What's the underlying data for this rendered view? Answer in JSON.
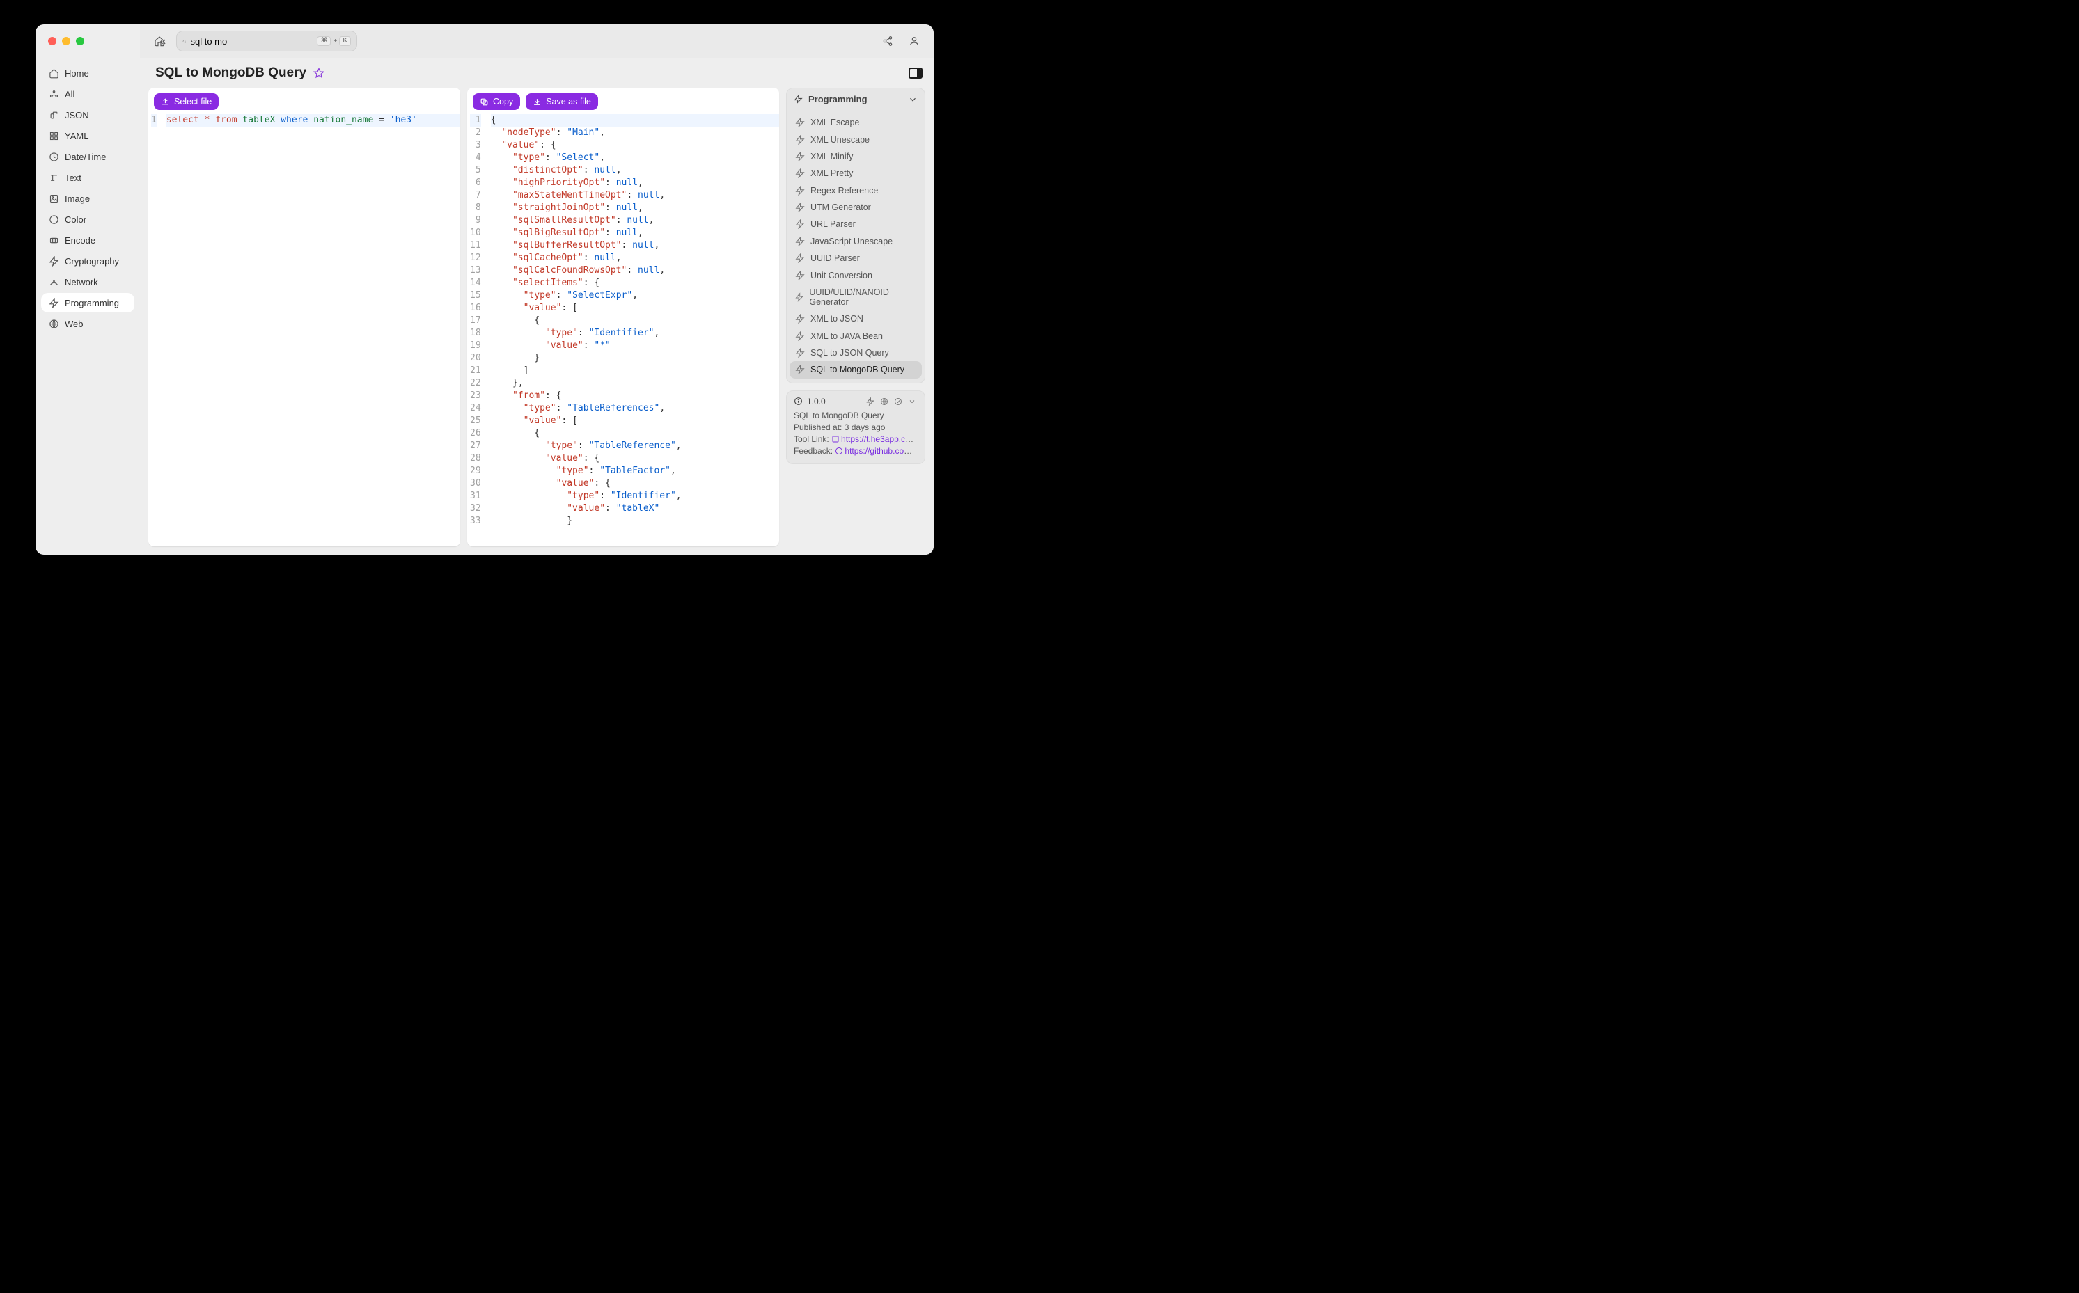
{
  "search": {
    "value": "sql to mo",
    "shortcut_mod": "⌘",
    "shortcut_plus": "+",
    "shortcut_key": "K"
  },
  "sidebar": {
    "items": [
      {
        "label": "Home"
      },
      {
        "label": "All"
      },
      {
        "label": "JSON"
      },
      {
        "label": "YAML"
      },
      {
        "label": "Date/Time"
      },
      {
        "label": "Text"
      },
      {
        "label": "Image"
      },
      {
        "label": "Color"
      },
      {
        "label": "Encode"
      },
      {
        "label": "Cryptography"
      },
      {
        "label": "Network"
      },
      {
        "label": "Programming",
        "active": true
      },
      {
        "label": "Web"
      }
    ]
  },
  "page": {
    "title": "SQL to MongoDB Query"
  },
  "buttons": {
    "select_file": "Select file",
    "copy": "Copy",
    "save_as_file": "Save as file"
  },
  "input_code": {
    "tokens": [
      {
        "t": "select",
        "c": "tok-kw"
      },
      {
        "t": " "
      },
      {
        "t": "*",
        "c": "tok-op"
      },
      {
        "t": " "
      },
      {
        "t": "from",
        "c": "tok-kw"
      },
      {
        "t": " "
      },
      {
        "t": "tableX",
        "c": "tok-id"
      },
      {
        "t": " "
      },
      {
        "t": "where",
        "c": "tok-func"
      },
      {
        "t": " "
      },
      {
        "t": "nation_name",
        "c": "tok-id"
      },
      {
        "t": " "
      },
      {
        "t": "=",
        "c": ""
      },
      {
        "t": " "
      },
      {
        "t": "'he3'",
        "c": "tok-str"
      }
    ]
  },
  "output_lines": [
    "{",
    "  \"nodeType\": \"Main\",",
    "  \"value\": {",
    "    \"type\": \"Select\",",
    "    \"distinctOpt\": null,",
    "    \"highPriorityOpt\": null,",
    "    \"maxStateMentTimeOpt\": null,",
    "    \"straightJoinOpt\": null,",
    "    \"sqlSmallResultOpt\": null,",
    "    \"sqlBigResultOpt\": null,",
    "    \"sqlBufferResultOpt\": null,",
    "    \"sqlCacheOpt\": null,",
    "    \"sqlCalcFoundRowsOpt\": null,",
    "    \"selectItems\": {",
    "      \"type\": \"SelectExpr\",",
    "      \"value\": [",
    "        {",
    "          \"type\": \"Identifier\",",
    "          \"value\": \"*\"",
    "        }",
    "      ]",
    "    },",
    "    \"from\": {",
    "      \"type\": \"TableReferences\",",
    "      \"value\": [",
    "        {",
    "          \"type\": \"TableReference\",",
    "          \"value\": {",
    "            \"type\": \"TableFactor\",",
    "            \"value\": {",
    "              \"type\": \"Identifier\",",
    "              \"value\": \"tableX\"",
    "              }"
  ],
  "right": {
    "header": "Programming",
    "items": [
      {
        "label": "XML Escape"
      },
      {
        "label": "XML Unescape"
      },
      {
        "label": "XML Minify"
      },
      {
        "label": "XML Pretty"
      },
      {
        "label": "Regex Reference"
      },
      {
        "label": "UTM Generator"
      },
      {
        "label": "URL Parser"
      },
      {
        "label": "JavaScript Unescape"
      },
      {
        "label": "UUID Parser"
      },
      {
        "label": "Unit Conversion"
      },
      {
        "label": "UUID/ULID/NANOID Generator"
      },
      {
        "label": "XML to JSON"
      },
      {
        "label": "XML to JAVA Bean"
      },
      {
        "label": "SQL to JSON Query"
      },
      {
        "label": "SQL to MongoDB Query",
        "active": true
      }
    ]
  },
  "info": {
    "version": "1.0.0",
    "name": "SQL to MongoDB Query",
    "published_label": "Published at:",
    "published_value": "3 days ago",
    "tool_link_label": "Tool Link:",
    "tool_link_value": "https://t.he3app.co…",
    "feedback_label": "Feedback:",
    "feedback_value": "https://github.com/…"
  }
}
